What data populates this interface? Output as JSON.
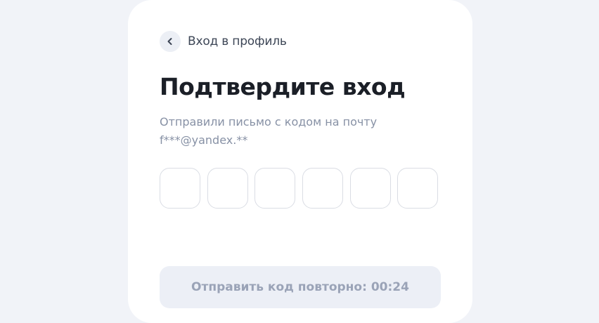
{
  "back": {
    "icon": "chevron-left-icon",
    "label": "Вход в профиль"
  },
  "title": "Подтвердите вход",
  "subtitle": {
    "line1": "Отправили письмо с кодом на почту",
    "line2": "f***@yandex.**"
  },
  "code_inputs": [
    "",
    "",
    "",
    "",
    "",
    ""
  ],
  "resend_button": {
    "label": "Отправить код повторно: 00:24",
    "disabled": true
  },
  "colors": {
    "page_background": "#f1f3f8",
    "card_background": "#ffffff",
    "title_text": "#1b1f27",
    "muted_text": "#8791a5",
    "disabled_button_bg": "#eceff6",
    "disabled_button_text": "#9aa3b7"
  }
}
